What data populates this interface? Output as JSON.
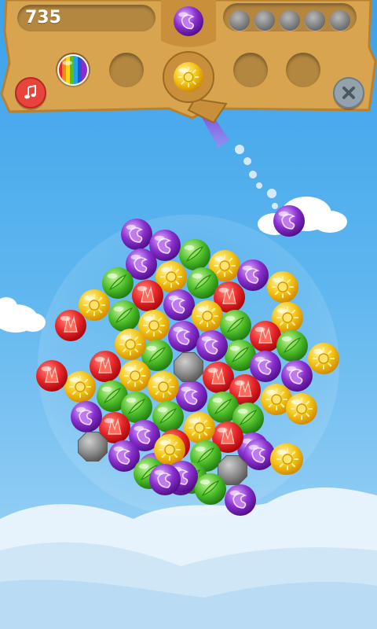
{
  "hud": {
    "score": "735",
    "progress": {
      "total": 5,
      "filled": 0
    },
    "next_bubble": "purple",
    "current_bubble": "yellow",
    "powerups": [
      "rainbow",
      "empty",
      "empty",
      "empty"
    ]
  },
  "colors": {
    "wood": "#d9a44f",
    "wood_dark": "#b38740",
    "sky_top": "#3ba1ea",
    "red": "#e8262a",
    "green": "#4fbf2a",
    "yellow": "#f5c516",
    "purple": "#8a2fcf",
    "stone": "#8c8c8c"
  },
  "board": {
    "flying_bubble": "purple",
    "bubbles": [
      "purple",
      "purple",
      "purple",
      "green",
      "yellow",
      "green",
      "yellow",
      "red",
      "green",
      "purple",
      "yellow",
      "red",
      "purple",
      "green",
      "red",
      "yellow",
      "yellow",
      "yellow",
      "green",
      "yellow",
      "red",
      "green",
      "purple",
      "yellow",
      "green",
      "purple",
      "green",
      "red",
      "purple",
      "yellow",
      "red",
      "yellow",
      "red",
      "green",
      "purple",
      "yellow",
      "purple",
      "green",
      "stone",
      "red",
      "yellow",
      "red",
      "green",
      "yellow",
      "purple",
      "yellow",
      "purple",
      "green",
      "green",
      "purple",
      "red",
      "purple",
      "stone",
      "yellow",
      "red",
      "purple",
      "yellow",
      "purple",
      "green",
      "green",
      "yellow",
      "green",
      "purple",
      "purple",
      "stone",
      "green",
      "purple",
      "purple",
      "yellow"
    ]
  }
}
